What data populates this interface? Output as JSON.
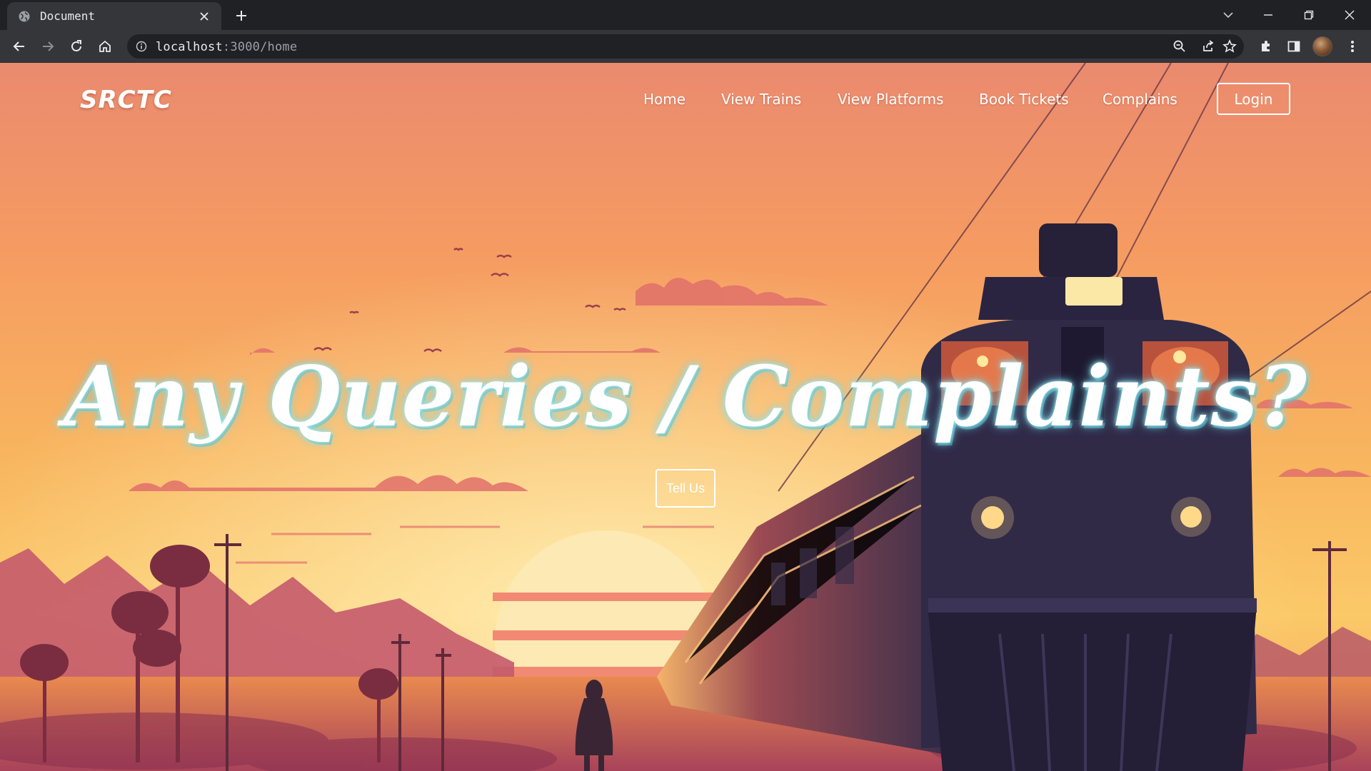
{
  "browser": {
    "tab": {
      "title": "Document",
      "favicon": "globe-icon"
    },
    "url": {
      "host": "localhost",
      "path": ":3000/home"
    },
    "toolbar_icons": [
      "back-icon",
      "forward-icon",
      "reload-icon",
      "home-icon",
      "info-icon",
      "zoom-icon",
      "share-icon",
      "star-icon",
      "extensions-icon",
      "side-panel-icon",
      "avatar",
      "menu-icon"
    ]
  },
  "site": {
    "brand": "SRCTC",
    "nav": [
      {
        "label": "Home"
      },
      {
        "label": "View Trains"
      },
      {
        "label": "View Platforms"
      },
      {
        "label": "Book Tickets"
      },
      {
        "label": "Complains"
      }
    ],
    "login_label": "Login",
    "hero": {
      "title": "Any Queries / Complaints?",
      "button_label": "Tell Us"
    }
  },
  "colors": {
    "sky_top": "#ef8a6b",
    "sky_mid": "#f7a85a",
    "sky_low": "#f9c45d",
    "sun": "#fde9b3",
    "train": "#2f2a45",
    "hills": "#c0506a",
    "text": "#ffffff",
    "title_glow": "#6fd7e6"
  }
}
